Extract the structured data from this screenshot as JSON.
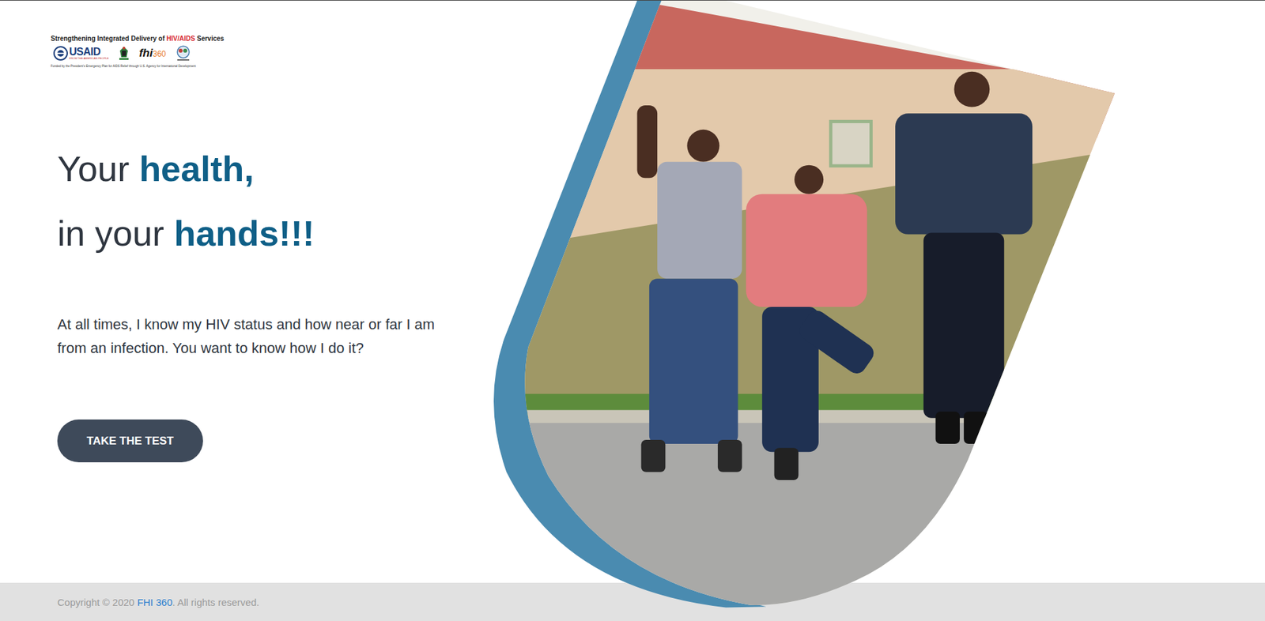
{
  "logo": {
    "title_parts": [
      {
        "text": "Strengthening Integrated Delivery of ",
        "highlight": false
      },
      {
        "text": "HIV/AIDS",
        "highlight": true
      },
      {
        "text": " Services",
        "highlight": false
      }
    ],
    "usaid": "USAID",
    "usaid_tagline": "FROM THE AMERICAN PEOPLE",
    "fhi": "fhi",
    "fhi_number": "360",
    "funding": "Funded by the President's Emergency Plan for AIDS Relief through U.S. Agency for International Development"
  },
  "hero": {
    "heading": [
      [
        {
          "text": "Your ",
          "emphasis": false
        },
        {
          "text": "health,",
          "emphasis": true
        }
      ],
      [
        {
          "text": "in your ",
          "emphasis": false
        },
        {
          "text": "hands!!!",
          "emphasis": true
        }
      ]
    ],
    "body": "At all times, I know my HIV status and how near or far I am from an infection. You want to know how I do it?",
    "button": "TAKE THE TEST"
  },
  "footer": {
    "prefix": "Copyright © 2020 ",
    "link": "FHI 360",
    "suffix": ". All rights reserved."
  }
}
